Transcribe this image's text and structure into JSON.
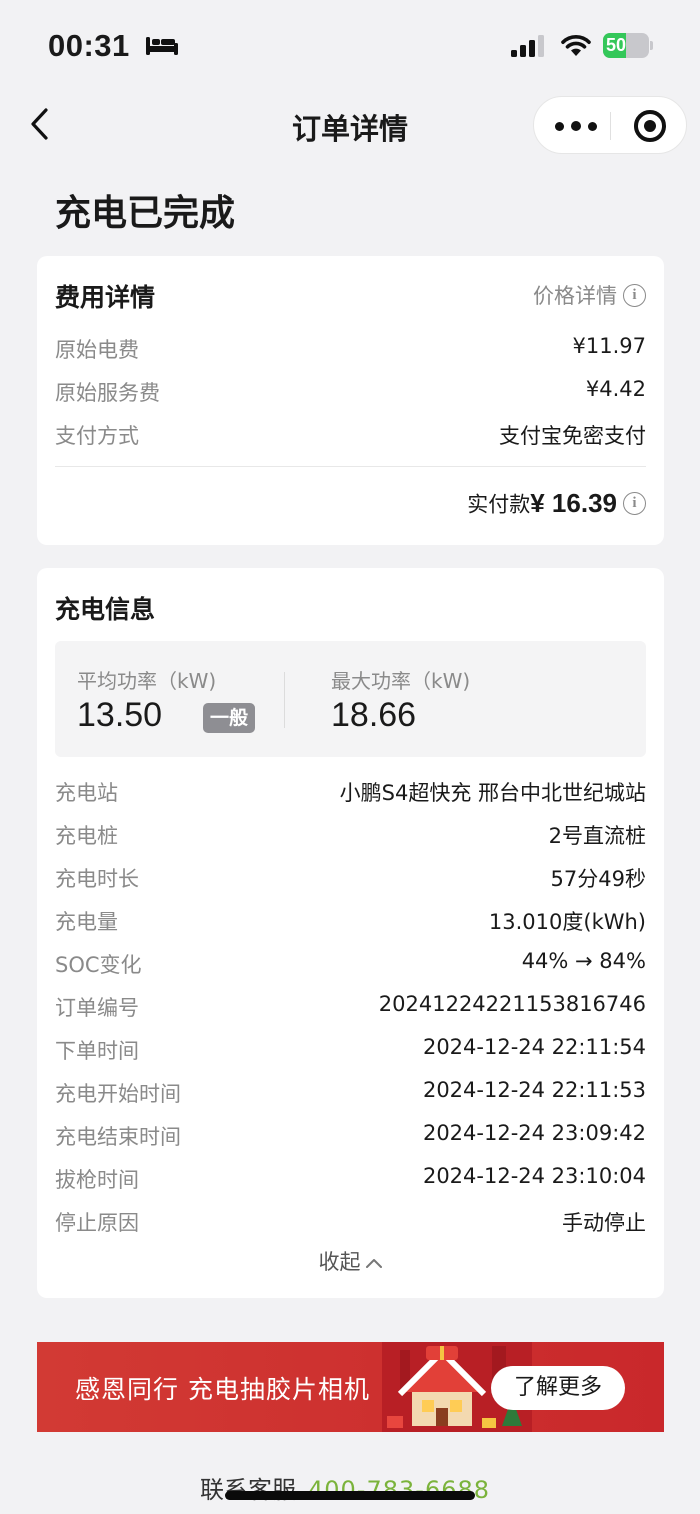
{
  "status_bar": {
    "time": "00:31",
    "battery": "50",
    "battery_level": 0.5
  },
  "nav": {
    "title": "订单详情"
  },
  "order_status": "充电已完成",
  "fee_card": {
    "title": "费用详情",
    "price_detail_link": "价格详情",
    "rows": [
      {
        "label": "原始电费",
        "value": "¥11.97"
      },
      {
        "label": "原始服务费",
        "value": "¥4.42"
      },
      {
        "label": "支付方式",
        "value": "支付宝免密支付"
      }
    ],
    "total_label": "实付款",
    "total_amount": "¥ 16.39"
  },
  "charge_card": {
    "title": "充电信息",
    "avg_power_label": "平均功率（kW)",
    "avg_power_value": "13.50",
    "level_badge": "一般",
    "max_power_label": "最大功率（kW)",
    "max_power_value": "18.66",
    "rows": [
      {
        "label": "充电站",
        "value": "小鹏S4超快充 邢台中北世纪城站"
      },
      {
        "label": "充电桩",
        "value": "2号直流桩"
      },
      {
        "label": "充电时长",
        "value": "57分49秒"
      },
      {
        "label": "充电量",
        "value": "13.010度(kWh)"
      },
      {
        "label": "SOC变化",
        "value": "44% → 84%"
      },
      {
        "label": "订单编号",
        "value": "20241224221153816746"
      },
      {
        "label": "下单时间",
        "value": "2024-12-24 22:11:54"
      },
      {
        "label": "充电开始时间",
        "value": "2024-12-24 22:11:53"
      },
      {
        "label": "充电结束时间",
        "value": "2024-12-24 23:09:42"
      },
      {
        "label": "拔枪时间",
        "value": "2024-12-24 23:10:04"
      },
      {
        "label": "停止原因",
        "value": "手动停止"
      }
    ],
    "collapse_label": "收起"
  },
  "banner": {
    "text": "感恩同行 充电抽胶片相机",
    "button": "了解更多"
  },
  "service": {
    "label": "联系客服",
    "phone": "400-783-6688"
  },
  "colors": {
    "accent_green": "#7bb33b",
    "banner_red": "#d23a34",
    "battery_green": "#34c759"
  }
}
